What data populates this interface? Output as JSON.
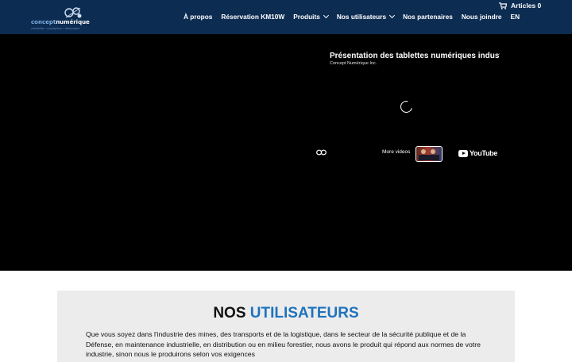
{
  "header": {
    "logo": {
      "text_part1": "concept",
      "text_part2": "numérique",
      "tagline": "créativité • conception • fabrication"
    },
    "cart": {
      "label": "Articles 0",
      "icon": "cart-icon"
    },
    "nav": [
      {
        "label": "À propos"
      },
      {
        "label": "Réservation KM10W"
      },
      {
        "label": "Produits",
        "has_dropdown": true
      },
      {
        "label": "Nos utilisateurs",
        "has_dropdown": true
      },
      {
        "label": "Nos partenaires"
      },
      {
        "label": "Nous joindre"
      },
      {
        "label": "EN"
      }
    ]
  },
  "video": {
    "title": "Présentation des tablettes numériques industrielles",
    "channel": "Concept Numérique Inc.",
    "more_videos": "More videos",
    "brand": "YouTube"
  },
  "users": {
    "title_part1": "NOS",
    "title_part2": "UTILISATEURS",
    "description": "Que vous soyez dans l'industrie des mines, des transports et de la logistique, dans le secteur de la sécurité publique et de la Défense, en maintenance industrielle, en distribution ou en milieu forestier, nous avons le produit qui répond aux normes de votre industrie, sinon nous le produirons selon vos exigences"
  },
  "colors": {
    "header_bg": "#0d2c52",
    "accent": "#1e73be",
    "section_bg": "#ececec"
  }
}
